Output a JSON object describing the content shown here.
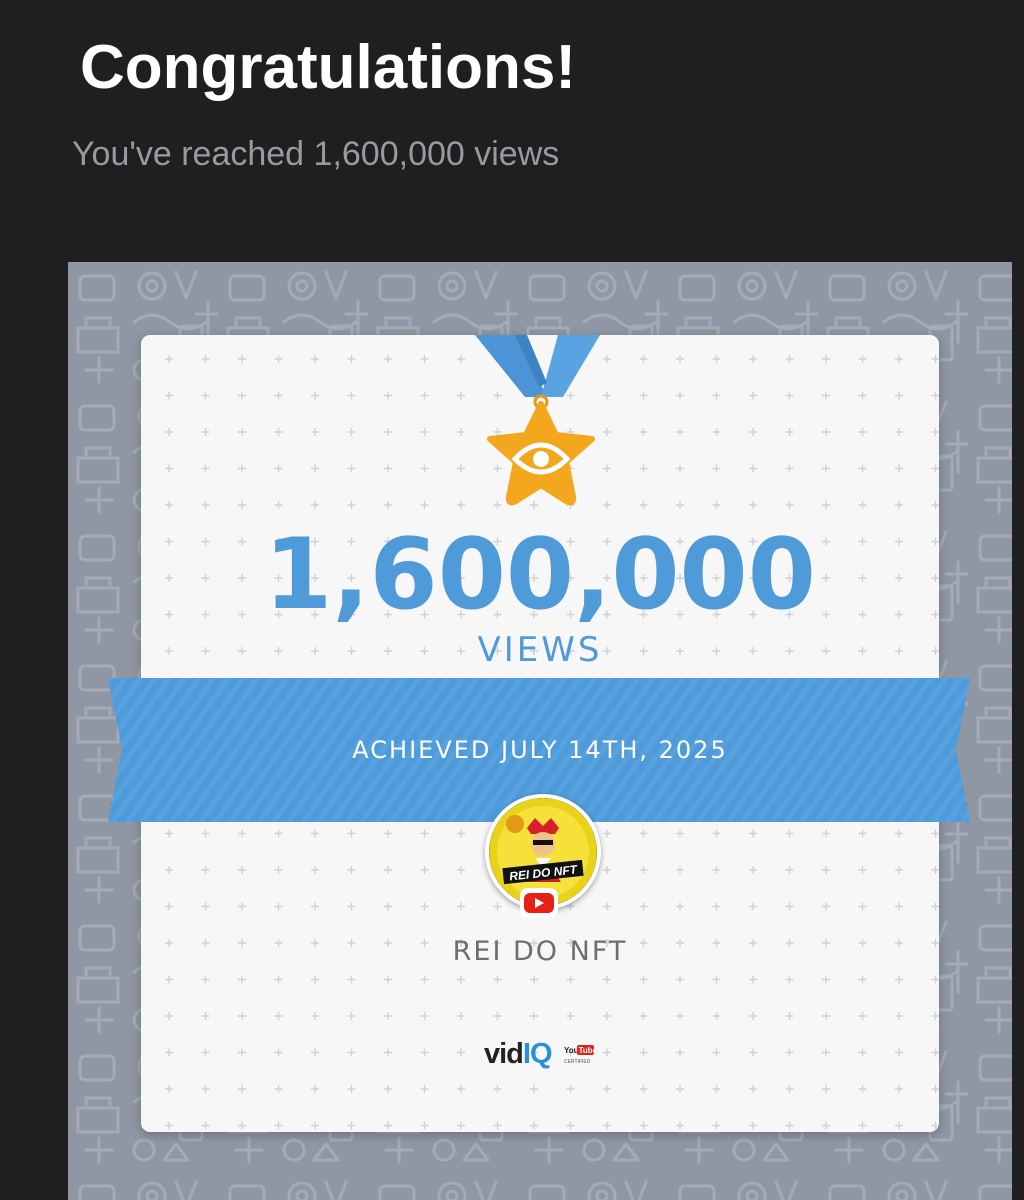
{
  "header": {
    "title": "Congratulations!",
    "subtitle": "You've reached 1,600,000 views"
  },
  "milestone": {
    "count": "1,600,000",
    "unit": "VIEWS",
    "achieved": "ACHIEVED JULY 14TH, 2025",
    "icon": "eye-star-medal-icon"
  },
  "channel": {
    "name": "REI DO NFT",
    "avatar_text": "REI DO NFT",
    "platform_icon": "youtube-icon"
  },
  "branding": {
    "vid": "vid",
    "iq": "IQ",
    "cert_top": "You",
    "cert_tube": "Tube",
    "cert_sub": "CERTIFIED"
  },
  "colors": {
    "background": "#1f1f22",
    "accent_blue": "#4f9ad9",
    "medal_gold": "#f3a71c",
    "youtube_red": "#e62117",
    "pattern_gray": "#8f97a4"
  }
}
